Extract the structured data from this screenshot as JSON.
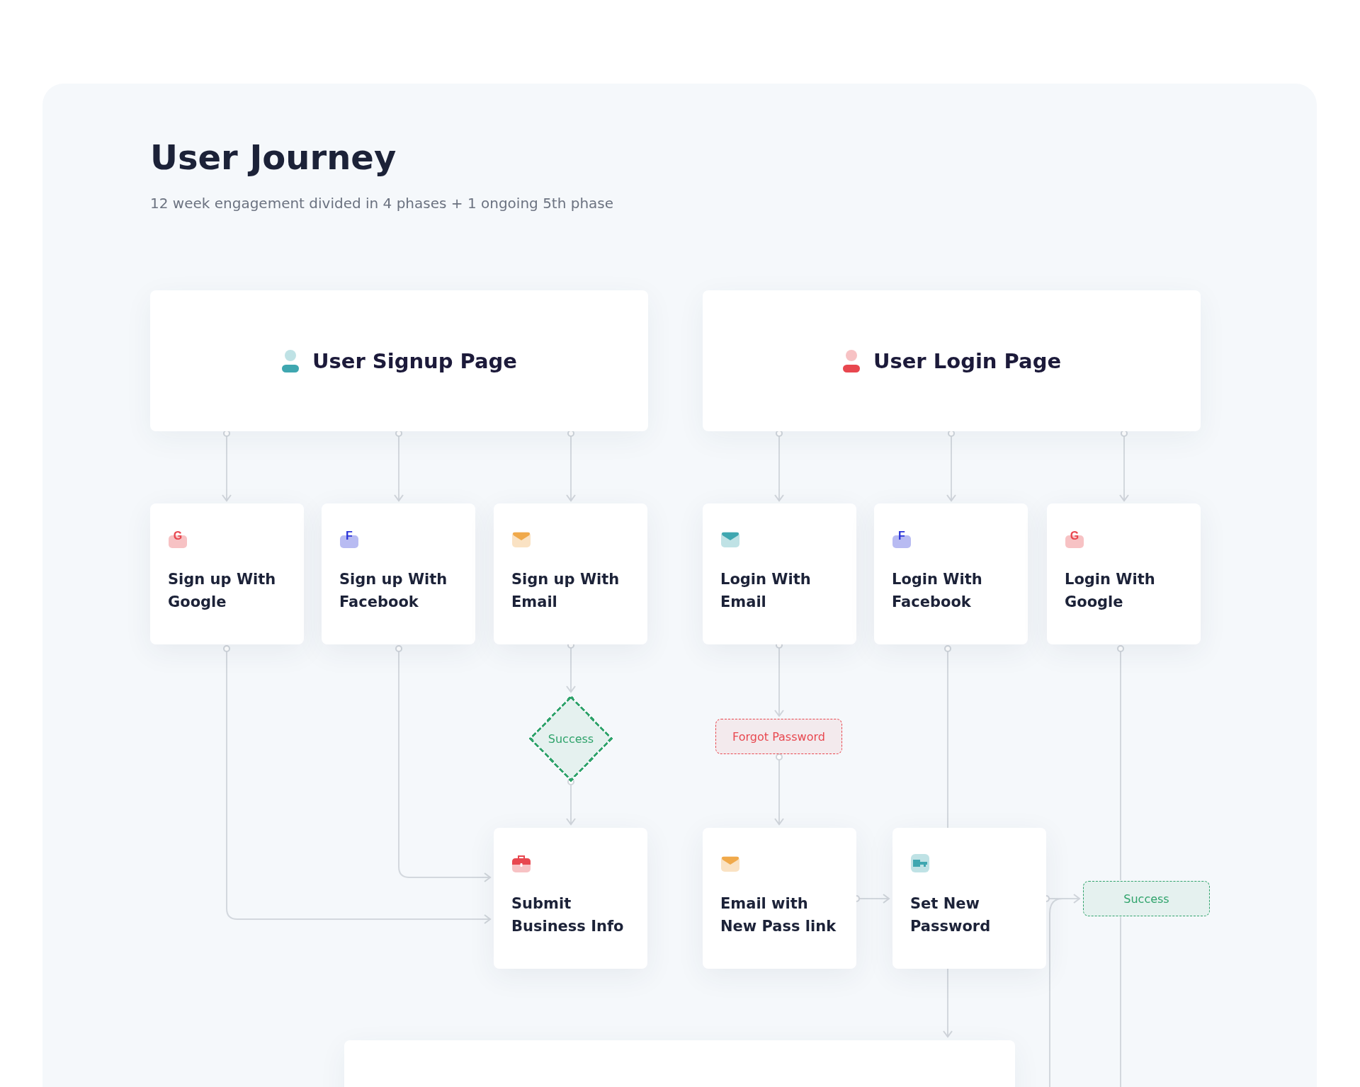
{
  "title": "User Journey",
  "subtitle": "12 week engagement divided in 4 phases + 1 ongoing 5th phase",
  "pages": [
    {
      "label": "User Signup Page",
      "color": "#3fa7b0"
    },
    {
      "label": "User Login Page",
      "color": "#e8474f"
    }
  ],
  "cards": [
    {
      "label": "Sign up With\nGoogle",
      "kind": "letter",
      "icon_text": "G",
      "color": "#e8474f"
    },
    {
      "label": "Sign up With\nFacebook",
      "kind": "letter",
      "icon_text": "F",
      "color": "#2a33d8"
    },
    {
      "label": "Sign up With\nEmail",
      "kind": "mail",
      "color": "#f0a94a"
    },
    {
      "label": "Login With\nEmail",
      "kind": "mail",
      "color": "#3fa7b0"
    },
    {
      "label": "Login With\nFacebook",
      "kind": "letter",
      "icon_text": "F",
      "color": "#2a33d8"
    },
    {
      "label": "Login With\nGoogle",
      "kind": "letter",
      "icon_text": "G",
      "color": "#e8474f"
    },
    {
      "label": "Submit\nBusiness Info",
      "kind": "briefcase",
      "color": "#e8474f"
    },
    {
      "label": "Email with\nNew Pass link",
      "kind": "mail",
      "color": "#f0a94a"
    },
    {
      "label": "Set New\nPassword",
      "kind": "key",
      "color": "#3fa7b0"
    }
  ],
  "decisions": [
    {
      "label": "Success",
      "kind": "diamond",
      "color": "#2fa36b"
    },
    {
      "label": "Forgot Password",
      "kind": "tag",
      "color": "#e8474f"
    },
    {
      "label": "Success",
      "kind": "tag",
      "color": "#2fa36b"
    }
  ]
}
